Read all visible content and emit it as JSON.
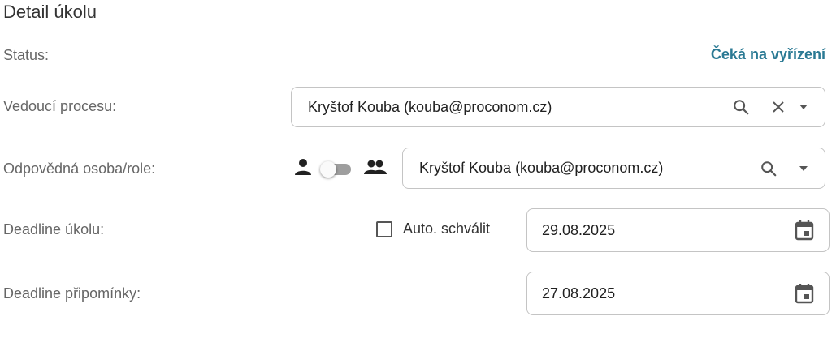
{
  "panel": {
    "title": "Detail úkolu"
  },
  "status": {
    "label": "Status:",
    "value": "Čeká na vyřízení",
    "color": "#2b7a94"
  },
  "process_lead": {
    "label": "Vedoucí procesu:",
    "value": "Kryštof Kouba (kouba@proconom.cz)",
    "icons": [
      "search-icon",
      "clear-icon",
      "dropdown-arrow-icon"
    ]
  },
  "responsible": {
    "label": "Odpovědná osoba/role:",
    "value": "Kryštof Kouba (kouba@proconom.cz)",
    "toggle": {
      "left_icon": "person-icon",
      "right_icon": "group-icon",
      "state": "person"
    },
    "icons": [
      "search-icon",
      "dropdown-arrow-icon"
    ]
  },
  "task_deadline": {
    "label": "Deadline úkolu:",
    "auto_approve_label": "Auto. schválit",
    "auto_approve_checked": false,
    "value": "29.08.2025",
    "icon": "calendar-icon"
  },
  "comment_deadline": {
    "label": "Deadline připomínky:",
    "value": "27.08.2025",
    "icon": "calendar-icon"
  }
}
